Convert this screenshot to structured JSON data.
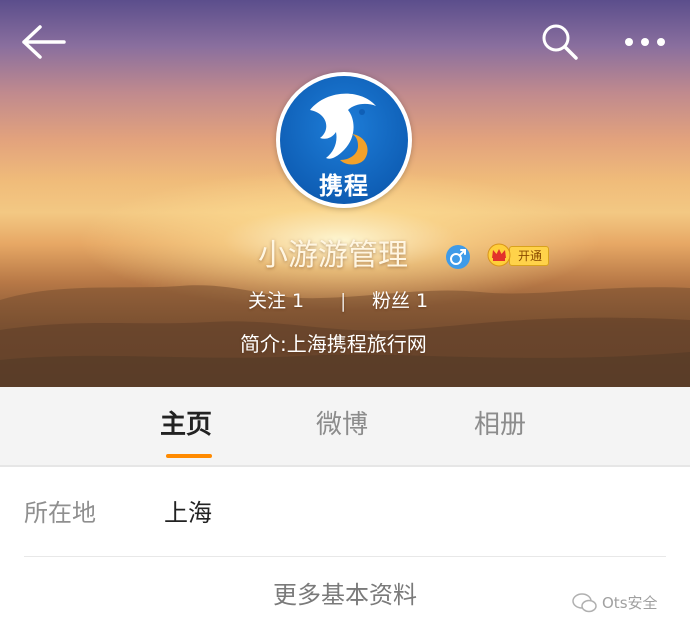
{
  "profile": {
    "username": "小游游管理",
    "vip_label": "开通",
    "follow_text": "关注 1",
    "fans_text": "粉丝 1",
    "separator": "|",
    "bio": "简介:上海携程旅行网",
    "avatar_logo_text": "携程"
  },
  "tabs": [
    {
      "label": "主页",
      "active": true
    },
    {
      "label": "微博",
      "active": false
    },
    {
      "label": "相册",
      "active": false
    }
  ],
  "info": {
    "location_label": "所在地",
    "location_value": "上海",
    "more_label": "更多基本资料"
  },
  "watermark": {
    "text": "Ots安全"
  },
  "icons": {
    "back": "arrow-left-icon",
    "search": "search-icon",
    "more": "more-dots-icon",
    "gender": "male-icon",
    "vip": "crown-icon"
  },
  "colors": {
    "accent_tab": "#ff8a00",
    "avatar_blue": "#0f5fb6",
    "gender_blue": "#3f9be8",
    "vip_gold": "#ffd24a"
  }
}
